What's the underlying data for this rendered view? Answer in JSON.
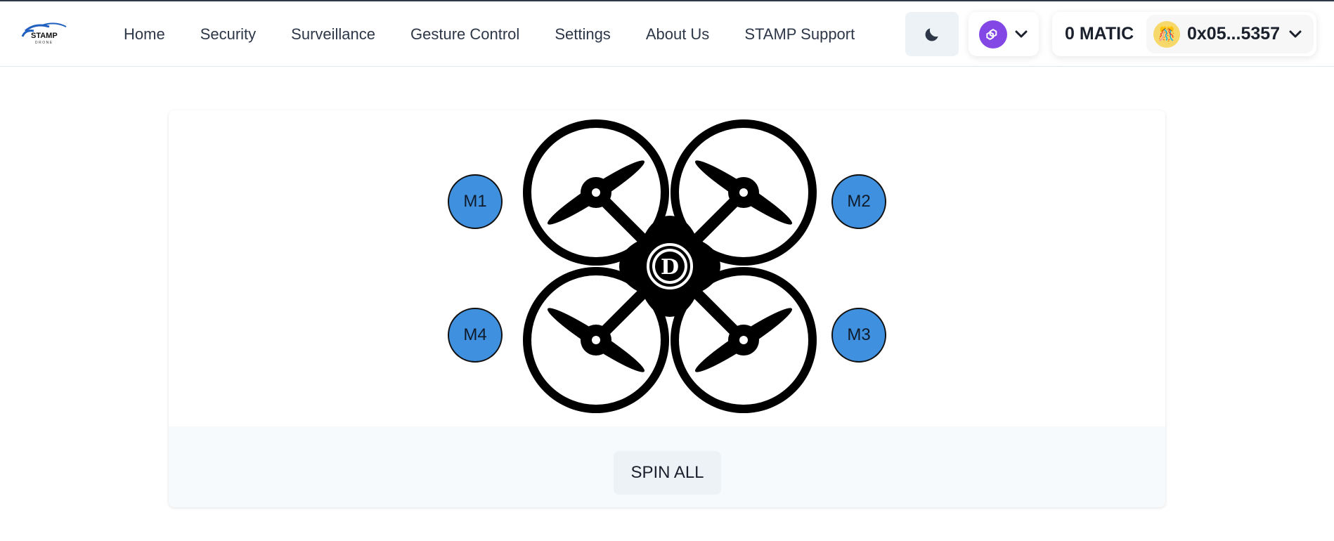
{
  "brand": {
    "logo_text": "STAMP",
    "logo_subtext": "DRONE"
  },
  "nav": {
    "items": [
      {
        "label": "Home",
        "name": "nav-home"
      },
      {
        "label": "Security",
        "name": "nav-security"
      },
      {
        "label": "Surveillance",
        "name": "nav-surveillance"
      },
      {
        "label": "Gesture Control",
        "name": "nav-gesture-control"
      },
      {
        "label": "Settings",
        "name": "nav-settings"
      },
      {
        "label": "About Us",
        "name": "nav-about-us"
      },
      {
        "label": "STAMP Support",
        "name": "nav-stamp-support"
      }
    ]
  },
  "header_controls": {
    "theme_icon": "moon-icon",
    "chain_icon": "polygon-icon",
    "chain_color": "#8247e5"
  },
  "wallet": {
    "balance": "0 MATIC",
    "address": "0x05...5357",
    "avatar_emoji": "🎊"
  },
  "motors": {
    "m1": "M1",
    "m2": "M2",
    "m3": "M3",
    "m4": "M4",
    "color": "#3f91e0"
  },
  "drone": {
    "hub_letter": "D"
  },
  "actions": {
    "spin_all_label": "SPIN ALL"
  }
}
